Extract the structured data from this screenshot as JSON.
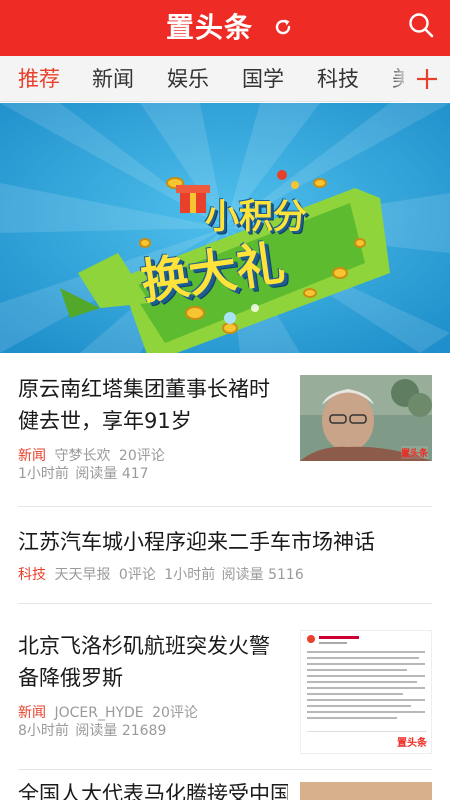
{
  "header": {
    "logo": "置头条",
    "accent_color": "#ee2b24"
  },
  "tabs": [
    "推荐",
    "新闻",
    "娱乐",
    "国学",
    "科技",
    "美"
  ],
  "tab_active": "推荐",
  "banner": {
    "line1": "小积分",
    "line2": "换大礼"
  },
  "news": [
    {
      "title": "原云南红塔集团董事长褚时健去世，享年91岁",
      "category": "新闻",
      "source": "守梦长欢",
      "comments": "20评论",
      "time": "1小时前",
      "reads": "阅读量 417",
      "thumb_watermark": "置头条"
    },
    {
      "title": "江苏汽车城小程序迎来二手车市场神话",
      "category": "科技",
      "source": "天天早报",
      "comments": "0评论",
      "time": "1小时前",
      "reads": "阅读量 5116"
    },
    {
      "title": "北京飞洛杉矶航班突发火警备降俄罗斯",
      "category": "新闻",
      "source": "JOCER_HYDE",
      "comments": "20评论",
      "time": "8小时前",
      "reads": "阅读量 21689",
      "thumb_watermark": "置头条"
    },
    {
      "title": "全国人大代表马化腾接受中国"
    }
  ]
}
